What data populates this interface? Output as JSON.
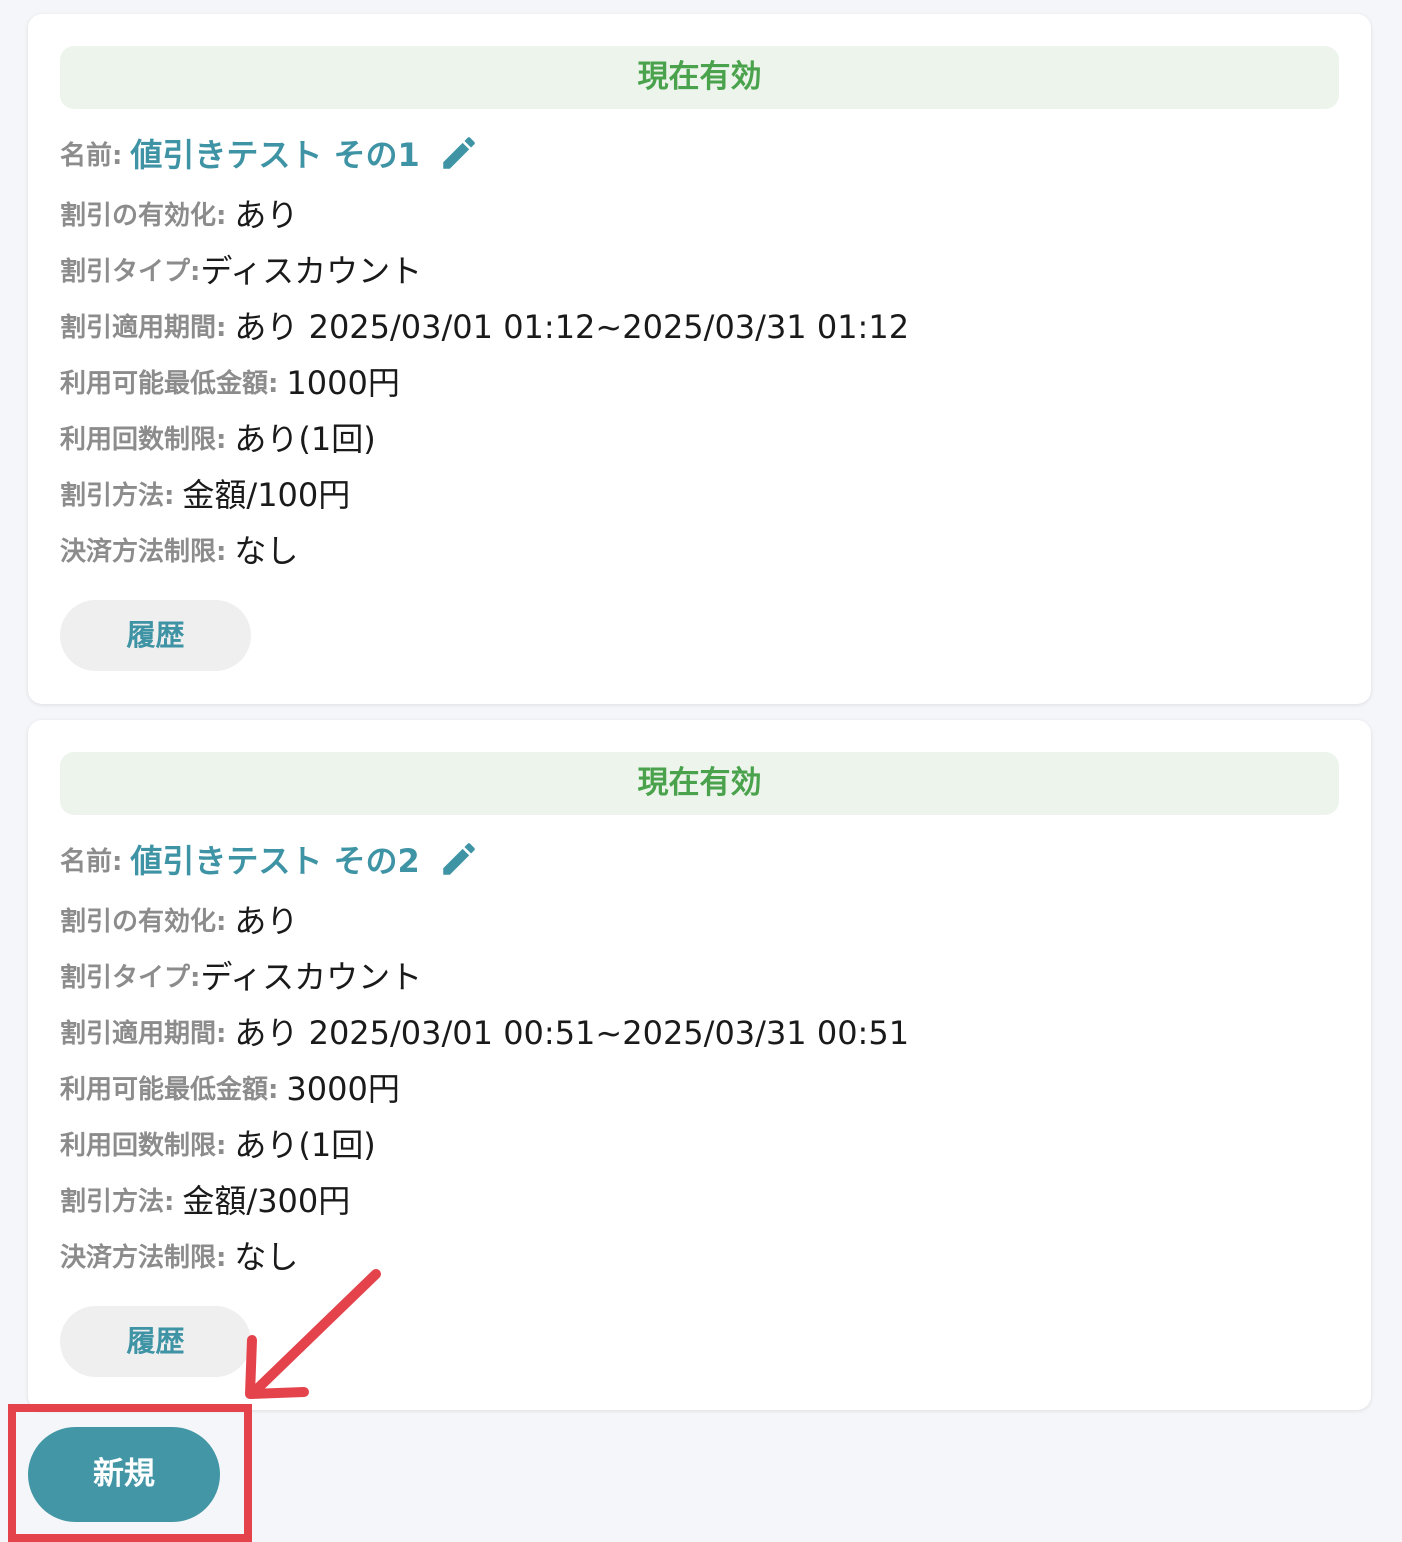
{
  "colors": {
    "accent": "#3e93a4",
    "status_green": "#4aa34c",
    "status_bg": "#ecf4ec",
    "highlight_red": "#e4434b",
    "new_button_bg": "#4296a5"
  },
  "labels": {
    "name": "名前:",
    "enabled": "割引の有効化:",
    "type": "割引タイプ:",
    "period": "割引適用期間:",
    "minimum": "利用可能最低金額:",
    "usage_limit": "利用回数制限:",
    "method": "割引方法:",
    "payment_restriction": "決済方法制限:"
  },
  "discounts": [
    {
      "status": "現在有効",
      "name": "値引きテスト その1",
      "edit_icon": "pencil-icon",
      "enabled": "あり",
      "type": "ディスカウント",
      "period": "あり 2025/03/01 01:12~2025/03/31 01:12",
      "minimum": "1000円",
      "usage_limit": "あり(1回)",
      "method": "金額/100円",
      "payment_restriction": "なし",
      "history_button": "履歴"
    },
    {
      "status": "現在有効",
      "name": "値引きテスト その2",
      "edit_icon": "pencil-icon",
      "enabled": "あり",
      "type": "ディスカウント",
      "period": "あり 2025/03/01 00:51~2025/03/31 00:51",
      "minimum": "3000円",
      "usage_limit": "あり(1回)",
      "method": "金額/300円",
      "payment_restriction": "なし",
      "history_button": "履歴"
    }
  ],
  "new_button": "新規",
  "annotation": {
    "highlight": "red-highlight-box",
    "arrow": "red-arrow-icon"
  }
}
